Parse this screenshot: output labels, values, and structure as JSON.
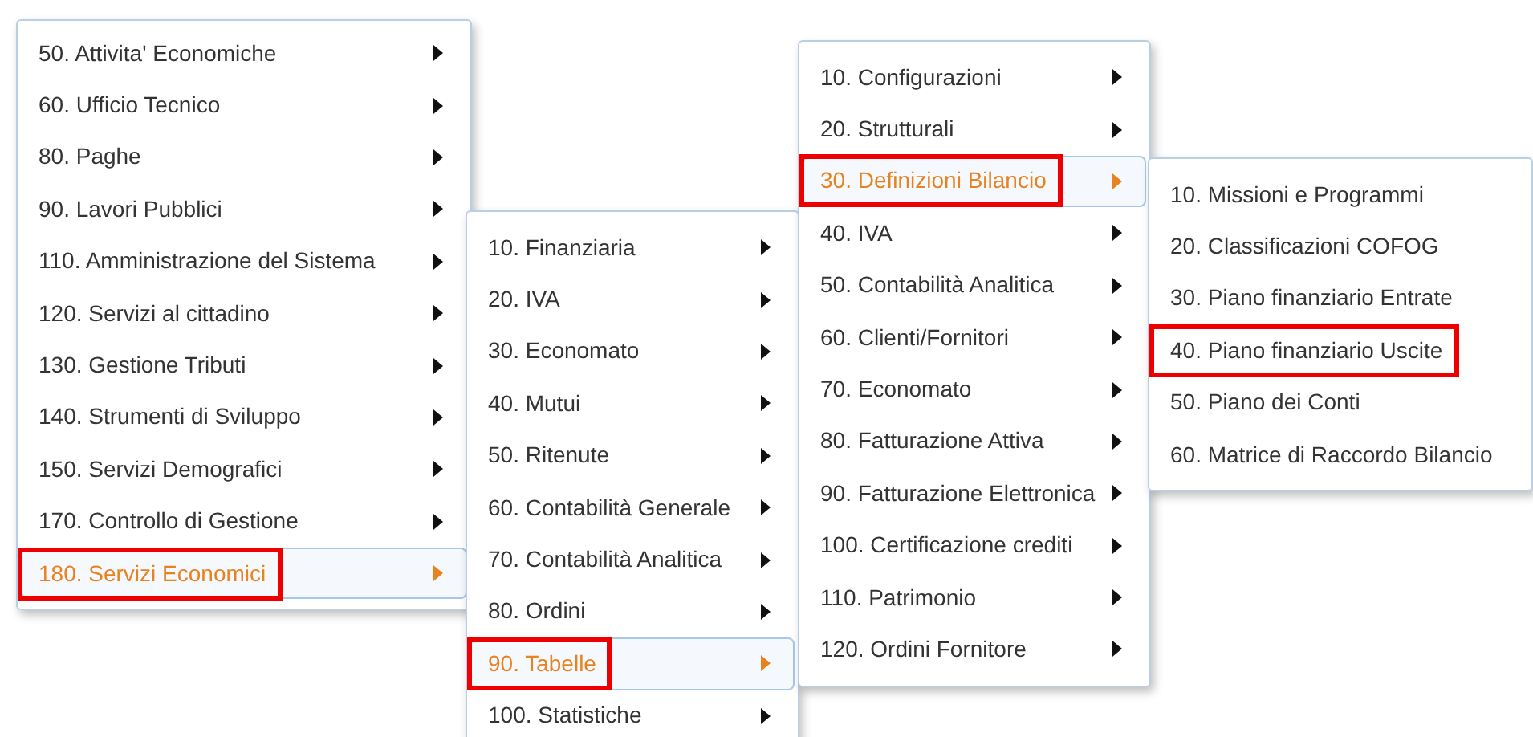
{
  "menus": [
    {
      "items": [
        {
          "label": "50. Attivita' Economiche",
          "selected": false,
          "marked": false,
          "submenu": true
        },
        {
          "label": "60. Ufficio Tecnico",
          "selected": false,
          "marked": false,
          "submenu": true
        },
        {
          "label": "80. Paghe",
          "selected": false,
          "marked": false,
          "submenu": true
        },
        {
          "label": "90. Lavori Pubblici",
          "selected": false,
          "marked": false,
          "submenu": true
        },
        {
          "label": "110. Amministrazione del Sistema",
          "selected": false,
          "marked": false,
          "submenu": true
        },
        {
          "label": "120. Servizi al cittadino",
          "selected": false,
          "marked": false,
          "submenu": true
        },
        {
          "label": "130. Gestione Tributi",
          "selected": false,
          "marked": false,
          "submenu": true
        },
        {
          "label": "140. Strumenti di Sviluppo",
          "selected": false,
          "marked": false,
          "submenu": true
        },
        {
          "label": "150. Servizi Demografici",
          "selected": false,
          "marked": false,
          "submenu": true
        },
        {
          "label": "170. Controllo di Gestione",
          "selected": false,
          "marked": false,
          "submenu": true
        },
        {
          "label": "180. Servizi Economici",
          "selected": true,
          "marked": true,
          "submenu": true
        }
      ]
    },
    {
      "items": [
        {
          "label": "10. Finanziaria",
          "selected": false,
          "marked": false,
          "submenu": true
        },
        {
          "label": "20. IVA",
          "selected": false,
          "marked": false,
          "submenu": true
        },
        {
          "label": "30. Economato",
          "selected": false,
          "marked": false,
          "submenu": true
        },
        {
          "label": "40. Mutui",
          "selected": false,
          "marked": false,
          "submenu": true
        },
        {
          "label": "50. Ritenute",
          "selected": false,
          "marked": false,
          "submenu": true
        },
        {
          "label": "60. Contabilità Generale",
          "selected": false,
          "marked": false,
          "submenu": true
        },
        {
          "label": "70. Contabilità Analitica",
          "selected": false,
          "marked": false,
          "submenu": true
        },
        {
          "label": "80. Ordini",
          "selected": false,
          "marked": false,
          "submenu": true
        },
        {
          "label": "90. Tabelle",
          "selected": true,
          "marked": true,
          "submenu": true
        },
        {
          "label": "100. Statistiche",
          "selected": false,
          "marked": false,
          "submenu": true
        }
      ]
    },
    {
      "items": [
        {
          "label": "10. Configurazioni",
          "selected": false,
          "marked": false,
          "submenu": true
        },
        {
          "label": "20. Strutturali",
          "selected": false,
          "marked": false,
          "submenu": true
        },
        {
          "label": "30. Definizioni Bilancio",
          "selected": true,
          "marked": true,
          "submenu": true
        },
        {
          "label": "40. IVA",
          "selected": false,
          "marked": false,
          "submenu": true
        },
        {
          "label": "50. Contabilità Analitica",
          "selected": false,
          "marked": false,
          "submenu": true
        },
        {
          "label": "60. Clienti/Fornitori",
          "selected": false,
          "marked": false,
          "submenu": true
        },
        {
          "label": "70. Economato",
          "selected": false,
          "marked": false,
          "submenu": true
        },
        {
          "label": "80. Fatturazione Attiva",
          "selected": false,
          "marked": false,
          "submenu": true
        },
        {
          "label": "90. Fatturazione Elettronica",
          "selected": false,
          "marked": false,
          "submenu": true
        },
        {
          "label": "100. Certificazione crediti",
          "selected": false,
          "marked": false,
          "submenu": true
        },
        {
          "label": "110. Patrimonio",
          "selected": false,
          "marked": false,
          "submenu": true
        },
        {
          "label": "120. Ordini Fornitore",
          "selected": false,
          "marked": false,
          "submenu": true
        }
      ]
    },
    {
      "items": [
        {
          "label": "10. Missioni e Programmi",
          "selected": false,
          "marked": false,
          "submenu": false
        },
        {
          "label": "20. Classificazioni COFOG",
          "selected": false,
          "marked": false,
          "submenu": false
        },
        {
          "label": "30. Piano finanziario Entrate",
          "selected": false,
          "marked": false,
          "submenu": false
        },
        {
          "label": "40. Piano finanziario Uscite",
          "selected": false,
          "marked": true,
          "submenu": false
        },
        {
          "label": "50. Piano dei Conti",
          "selected": false,
          "marked": false,
          "submenu": false
        },
        {
          "label": "60. Matrice di Raccordo Bilancio",
          "selected": false,
          "marked": false,
          "submenu": false
        }
      ]
    }
  ]
}
